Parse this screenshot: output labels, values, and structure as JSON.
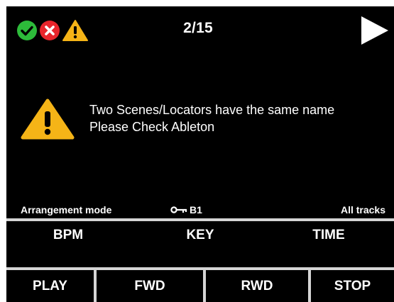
{
  "status": {
    "icons": [
      "check-circle-icon",
      "error-circle-icon",
      "warning-triangle-icon"
    ],
    "page_counter": "2/15",
    "colors": {
      "ok": "#2dbb3a",
      "error": "#e8252c",
      "warning": "#f5b417"
    }
  },
  "message": {
    "line1": "Two Scenes/Locators have the same name",
    "line2": "Please Check Ableton"
  },
  "info_row": {
    "mode": "Arrangement mode",
    "key_value": "B1",
    "tracks": "All tracks"
  },
  "fields": {
    "bpm": "BPM",
    "key": "KEY",
    "time": "TIME"
  },
  "buttons": {
    "play": "PLAY",
    "fwd": "FWD",
    "rwd": "RWD",
    "stop": "STOP"
  }
}
